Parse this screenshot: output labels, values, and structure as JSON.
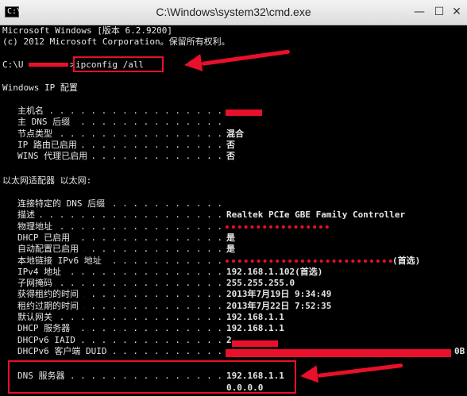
{
  "window": {
    "title": "C:\\Windows\\system32\\cmd.exe",
    "icon_glyph": "C:\\",
    "minimize": "—",
    "maximize": "☐",
    "close": "✕"
  },
  "header_lines": [
    "Microsoft Windows [版本 6.2.9200]",
    "(c) 2012 Microsoft Corporation。保留所有权利。"
  ],
  "prompt": {
    "prefix": "C:\\U",
    "suffix": ">",
    "command": "ipconfig /all"
  },
  "section_ip": "Windows IP 配置",
  "ip_config": [
    {
      "label": "主机名",
      "value": ""
    },
    {
      "label": "主 DNS 后缀",
      "value": ""
    },
    {
      "label": "节点类型",
      "value": "混合"
    },
    {
      "label": "IP 路由已启用",
      "value": "否"
    },
    {
      "label": "WINS 代理已启用",
      "value": "否"
    }
  ],
  "section_adapter": "以太网适配器 以太网:",
  "adapter": [
    {
      "label": "连接特定的 DNS 后缀",
      "value": ""
    },
    {
      "label": "描述",
      "value": "Realtek PCIe GBE Family Controller"
    },
    {
      "label": "物理地址",
      "value": ""
    },
    {
      "label": "DHCP 已启用",
      "value": "是"
    },
    {
      "label": "自动配置已启用",
      "value": "是"
    },
    {
      "label": "本地链接 IPv6 地址",
      "value": "(首选)"
    },
    {
      "label": "IPv4 地址",
      "value": "192.168.1.102(首选)"
    },
    {
      "label": "子网掩码",
      "value": "255.255.255.0"
    },
    {
      "label": "获得租约的时间",
      "value": "2013年7月19日 9:34:49"
    },
    {
      "label": "租约过期的时间",
      "value": "2013年7月22日 7:52:35"
    },
    {
      "label": "默认网关",
      "value": "192.168.1.1"
    },
    {
      "label": "DHCP 服务器",
      "value": "192.168.1.1"
    },
    {
      "label": "DHCPv6 IAID",
      "value": "2"
    },
    {
      "label": "DHCPv6 客户端 DUID",
      "value": "0B"
    },
    {
      "label": "DNS 服务器",
      "value": "192.168.1.1"
    },
    {
      "label": "",
      "value": "0.0.0.0"
    }
  ],
  "colors": {
    "background": "#000000",
    "text": "#e6e6e6",
    "annotation": "#e8102a"
  }
}
